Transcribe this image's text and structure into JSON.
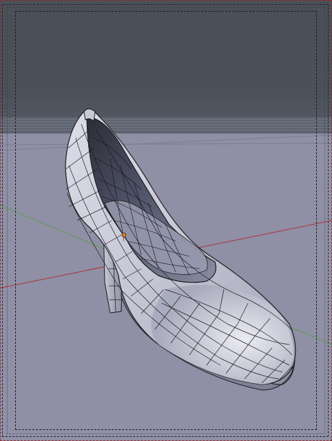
{
  "viewport": {
    "view": "camera",
    "colors": {
      "sky": "#4a4f58",
      "floor": "#8f8fa6",
      "x_axis": "#b03030",
      "y_axis": "#5f9e4a",
      "mesh_fill": "#d0d2de",
      "mesh_wire": "#1a1a1a",
      "origin": "#e08020",
      "frame": "#222222",
      "render_border": "#9a2a2a"
    },
    "object": {
      "type": "mesh",
      "subject": "high-heel-shoe",
      "mode": "edit-wireframe"
    }
  }
}
